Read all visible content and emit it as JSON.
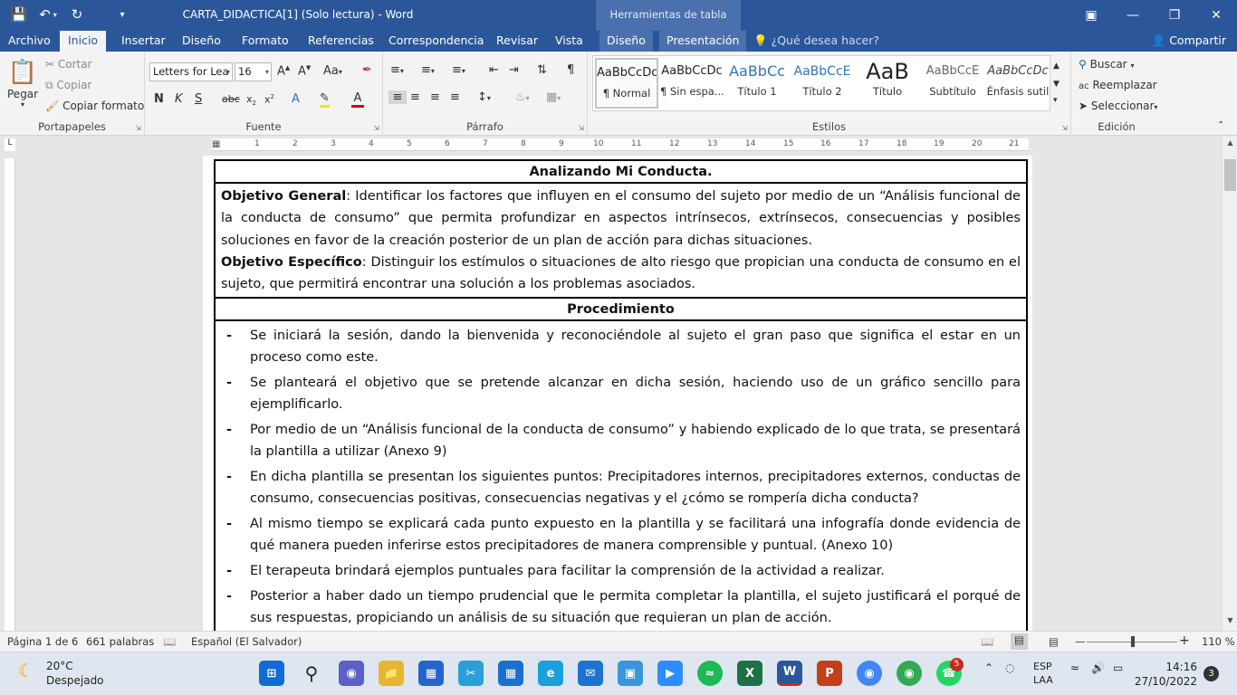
{
  "window": {
    "title": "CARTA_DIDACTICA[1] (Solo lectura) - Word",
    "contextual_group": "Herramientas de tabla"
  },
  "ribbon_tabs": [
    "Archivo",
    "Inicio",
    "Insertar",
    "Diseño",
    "Formato",
    "Referencias",
    "Correspondencia",
    "Revisar",
    "Vista",
    "Diseño",
    "Presentación"
  ],
  "tell_me": "¿Qué desea hacer?",
  "share": "Compartir",
  "clipboard": {
    "paste": "Pegar",
    "cut": "Cortar",
    "copy": "Copiar",
    "format_painter": "Copiar formato",
    "label": "Portapapeles"
  },
  "font": {
    "name": "Letters for Lea",
    "size": "16",
    "label": "Fuente"
  },
  "paragraph": {
    "label": "Párrafo"
  },
  "styles": {
    "label": "Estilos",
    "items": [
      {
        "preview": "AaBbCcDc",
        "name": "¶ Normal"
      },
      {
        "preview": "AaBbCcDc",
        "name": "¶ Sin espa..."
      },
      {
        "preview": "AaBbCc",
        "name": "Título 1"
      },
      {
        "preview": "AaBbCcE",
        "name": "Título 2"
      },
      {
        "preview": "AaB",
        "name": "Título"
      },
      {
        "preview": "AaBbCcE",
        "name": "Subtítulo"
      },
      {
        "preview": "AaBbCcDc",
        "name": "Énfasis sutil"
      }
    ]
  },
  "editing": {
    "find": "Buscar",
    "replace": "Reemplazar",
    "select": "Seleccionar",
    "label": "Edición"
  },
  "ruler": {
    "marks": [
      "1",
      "2",
      "3",
      "4",
      "5",
      "6",
      "7",
      "8",
      "9",
      "10",
      "11",
      "12",
      "13",
      "14",
      "15",
      "16",
      "17",
      "18",
      "19",
      "20",
      "21"
    ]
  },
  "document": {
    "title": "Analizando Mi Conducta.",
    "general_label": "Objetivo General",
    "general_text": ": Identificar los factores que influyen en el consumo del sujeto por medio de un “Análisis funcional de la conducta de consumo” que permita profundizar en aspectos intrínsecos, extrínsecos, consecuencias y posibles soluciones en favor de la creación posterior de un plan de acción para dichas situaciones.",
    "specific_label": "Objetivo Específico",
    "specific_text": ": Distinguir los estímulos o situaciones de alto riesgo que propician una conducta de consumo en el sujeto,  que permitirá encontrar una solución a los problemas asociados.",
    "procedure_title": "Procedimiento",
    "bullet": "-",
    "steps": [
      "Se iniciará la sesión, dando la bienvenida y reconociéndole al sujeto el gran paso que significa el estar en un proceso como este.",
      "Se planteará el objetivo que se pretende alcanzar en dicha sesión, haciendo uso de un gráfico sencillo para ejemplificarlo.",
      "Por medio de un “Análisis funcional de la conducta de consumo” y habiendo explicado de lo que trata, se presentará la plantilla a utilizar (Anexo 9)",
      "En dicha plantilla se presentan los siguientes puntos: Precipitadores internos, precipitadores externos, conductas de consumo, consecuencias positivas, consecuencias negativas y el ¿cómo se rompería dicha conducta?",
      "Al mismo tiempo se explicará cada punto expuesto en la plantilla y se facilitará una infografía donde evidencia de qué manera pueden inferirse estos precipitadores de manera comprensible y puntual. (Anexo 10)",
      "El terapeuta brindará ejemplos puntuales para facilitar la comprensión de la actividad a realizar.",
      "Posterior a haber dado un tiempo prudencial que le permita completar la plantilla, el sujeto justificará el porqué de sus respuestas, propiciando un análisis de su situación que requieran un plan de acción."
    ]
  },
  "status": {
    "page": "Página 1 de 6",
    "words": "661 palabras",
    "language": "Español (El Salvador)",
    "zoom": "110 %"
  },
  "taskbar": {
    "temperature": "20°C",
    "condition": "Despejado",
    "lang1": "ESP",
    "lang2": "LAA",
    "time": "14:16",
    "date": "27/10/2022",
    "notifications": "3",
    "whatsapp_badge": "5"
  },
  "colors": {
    "word_blue": "#2b579a",
    "ribbon_bg": "#f3f3f3"
  }
}
